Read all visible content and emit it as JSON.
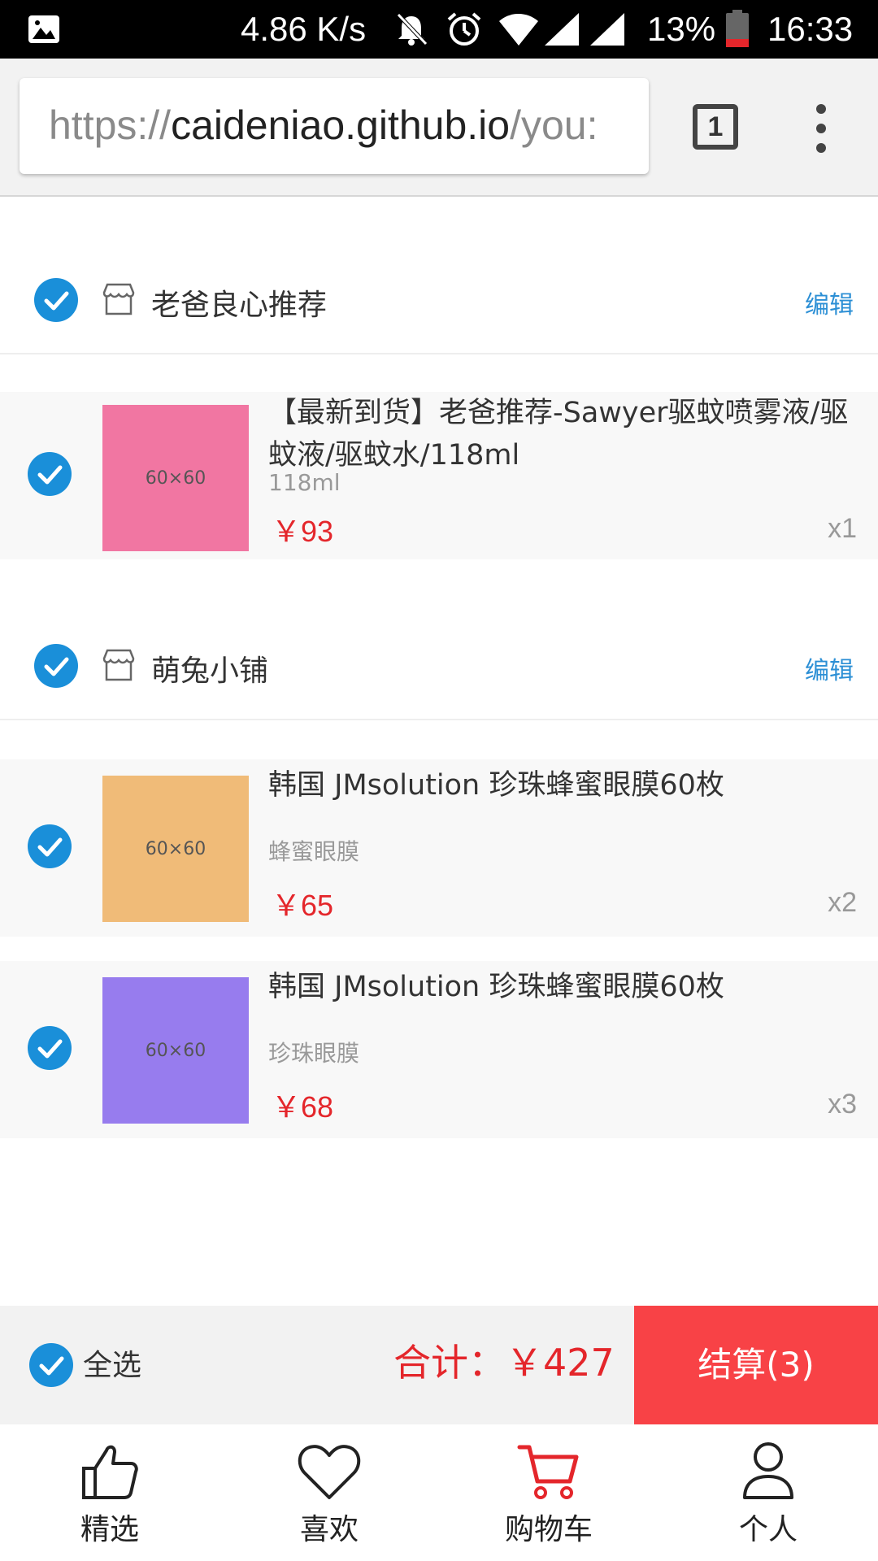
{
  "status_bar": {
    "net_speed": "4.86 K/s",
    "battery_percent": "13%",
    "time": "16:33",
    "icons": [
      "gallery-notification-icon",
      "mute-icon",
      "alarm-icon",
      "wifi-icon",
      "signal-icon",
      "signal-icon",
      "battery-low-icon"
    ]
  },
  "browser": {
    "url_scheme": "https://",
    "url_host": "caideniao.github.io",
    "url_path": "/you:",
    "tab_count": "1",
    "menu_icon": "overflow-menu-icon"
  },
  "shops": [
    {
      "name": "老爸良心推荐",
      "edit_label": "编辑",
      "items": [
        {
          "title": "【最新到货】老爸推荐-Sawyer驱蚊喷雾液/驱蚊液/驱蚊水/118ml",
          "sku": "118ml",
          "price": "￥93",
          "qty": "x1",
          "thumb_label": "60×60",
          "thumb_color": "#f176a2"
        }
      ]
    },
    {
      "name": "萌兔小铺",
      "edit_label": "编辑",
      "items": [
        {
          "title": "韩国 JMsolution 珍珠蜂蜜眼膜60枚",
          "sku": "蜂蜜眼膜",
          "price": "￥65",
          "qty": "x2",
          "thumb_label": "60×60",
          "thumb_color": "#f0bb78"
        },
        {
          "title": "韩国 JMsolution 珍珠蜂蜜眼膜60枚",
          "sku": "珍珠眼膜",
          "price": "￥68",
          "qty": "x3",
          "thumb_label": "60×60",
          "thumb_color": "#977cee"
        }
      ]
    }
  ],
  "checkout": {
    "select_all_label": "全选",
    "total_text": "合计：￥427",
    "pay_label": "结算(3)"
  },
  "nav": {
    "items": [
      {
        "label": "精选",
        "icon": "thumbs-up-icon"
      },
      {
        "label": "喜欢",
        "icon": "heart-icon"
      },
      {
        "label": "购物车",
        "icon": "cart-icon"
      },
      {
        "label": "个人",
        "icon": "person-icon"
      }
    ]
  },
  "colors": {
    "accent_blue": "#1a8fd9",
    "price_red": "#e4262b",
    "pay_button": "#f84246",
    "link_blue": "#2c8fd5"
  }
}
